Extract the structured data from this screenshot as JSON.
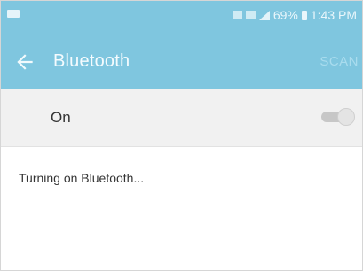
{
  "status_bar": {
    "battery_percent": "69%",
    "time": "1:43 PM"
  },
  "app_bar": {
    "title": "Bluetooth",
    "back_icon": "arrow-back-icon",
    "action_label": "SCAN"
  },
  "toggle": {
    "label": "On",
    "state": "on"
  },
  "content": {
    "message": "Turning on Bluetooth..."
  },
  "colors": {
    "header_bg": "#7fc6df",
    "row_bg": "#f1f1f1"
  }
}
